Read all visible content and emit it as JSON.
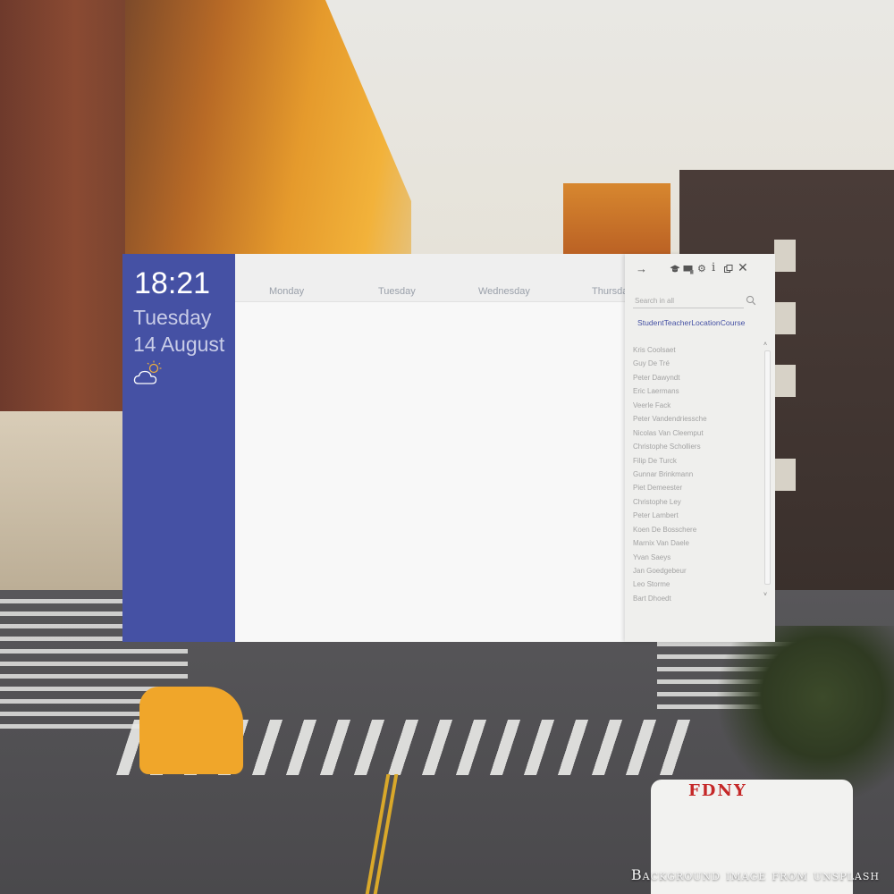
{
  "clock": {
    "time": "18:21",
    "day": "Tuesday",
    "date": "14 August",
    "weather_icon": "partly-cloudy-icon"
  },
  "calendar": {
    "days": [
      "Monday",
      "Tuesday",
      "Wednesday",
      "Thursday"
    ]
  },
  "sidebar": {
    "toolbar_icons": [
      "arrow-right-icon",
      "graduation-cap-icon",
      "presentation-icon",
      "gear-icon",
      "info-icon",
      "window-icon",
      "close-icon"
    ],
    "search": {
      "placeholder": "Search in all",
      "value": ""
    },
    "filters": [
      "Student",
      "Teacher",
      "Location",
      "Course"
    ],
    "results": [
      "Kris Coolsaet",
      "Guy De Tré",
      "Peter Dawyndt",
      "Eric Laermans",
      "Veerle Fack",
      "Peter Vandendriessche",
      "Nicolas Van Cleemput",
      "Christophe Scholliers",
      "Filip De Turck",
      "Gunnar Brinkmann",
      "Piet Demeester",
      "Christophe Ley",
      "Peter Lambert",
      "Koen De Bosschere",
      "Marnix Van Daele",
      "Yvan Saeys",
      "Jan Goedgebeur",
      "Leo Storme",
      "Bart Dhoedt"
    ]
  },
  "footer": {
    "credit": "Background image from unsplash"
  },
  "colors": {
    "accent": "#4551a4",
    "panel_bg": "#efefed",
    "calendar_bg": "#f8f8f8"
  }
}
